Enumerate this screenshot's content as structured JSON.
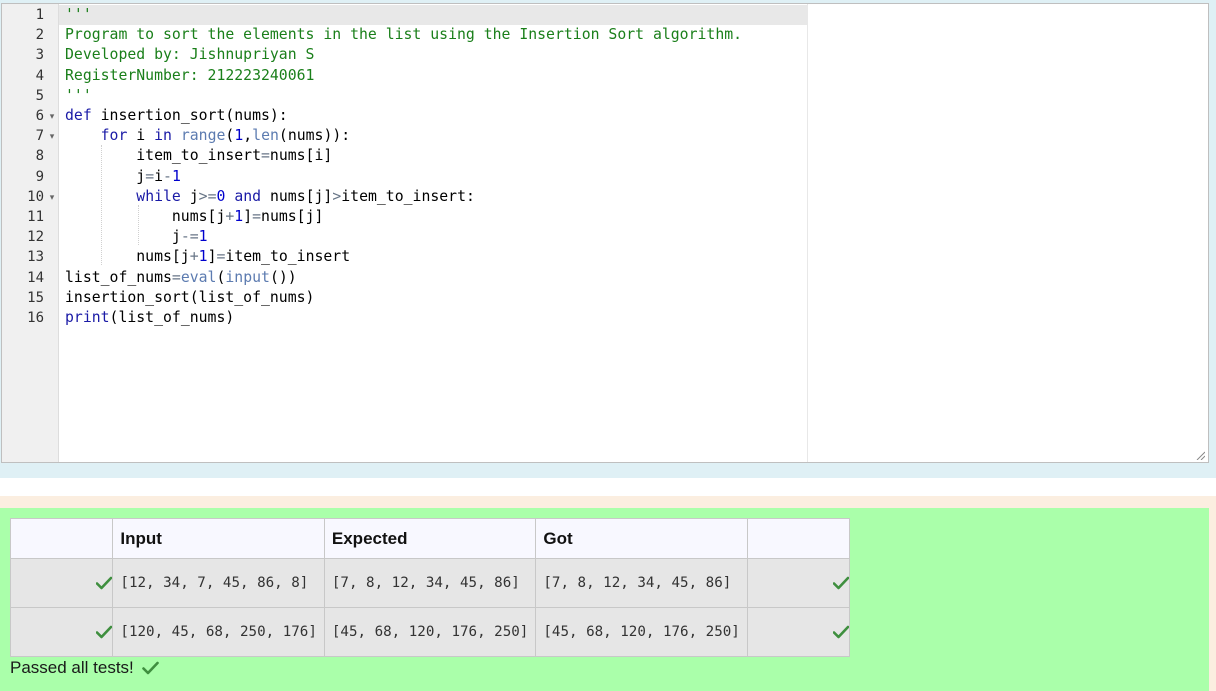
{
  "editor": {
    "line_numbers": [
      "1",
      "2",
      "3",
      "4",
      "5",
      "6",
      "7",
      "8",
      "9",
      "10",
      "11",
      "12",
      "13",
      "14",
      "15",
      "16"
    ],
    "folded_lines": [
      "6",
      "7",
      "10"
    ],
    "code_lines": [
      [
        {
          "t": "'''",
          "c": "str"
        }
      ],
      [
        {
          "t": "Program to sort the elements in the list using the Insertion Sort algorithm.",
          "c": "str"
        }
      ],
      [
        {
          "t": "Developed by: Jishnupriyan S",
          "c": "str"
        }
      ],
      [
        {
          "t": "RegisterNumber: 212223240061",
          "c": "str"
        }
      ],
      [
        {
          "t": "'''",
          "c": "str"
        }
      ],
      [
        {
          "t": "def",
          "c": "kw"
        },
        {
          "t": " insertion_sort(nums):",
          "c": ""
        }
      ],
      [
        {
          "t": "    ",
          "c": ""
        },
        {
          "t": "for",
          "c": "kw"
        },
        {
          "t": " i ",
          "c": ""
        },
        {
          "t": "in",
          "c": "kw"
        },
        {
          "t": " ",
          "c": ""
        },
        {
          "t": "range",
          "c": "bi"
        },
        {
          "t": "(",
          "c": ""
        },
        {
          "t": "1",
          "c": "num"
        },
        {
          "t": ",",
          "c": ""
        },
        {
          "t": "len",
          "c": "bi"
        },
        {
          "t": "(nums)):",
          "c": ""
        }
      ],
      [
        {
          "t": "        item_to_insert",
          "c": ""
        },
        {
          "t": "=",
          "c": "op"
        },
        {
          "t": "nums[i]",
          "c": ""
        }
      ],
      [
        {
          "t": "        j",
          "c": ""
        },
        {
          "t": "=",
          "c": "op"
        },
        {
          "t": "i",
          "c": ""
        },
        {
          "t": "-",
          "c": "op"
        },
        {
          "t": "1",
          "c": "num"
        }
      ],
      [
        {
          "t": "        ",
          "c": ""
        },
        {
          "t": "while",
          "c": "kw"
        },
        {
          "t": " j",
          "c": ""
        },
        {
          "t": ">=",
          "c": "op"
        },
        {
          "t": "0",
          "c": "num"
        },
        {
          "t": " ",
          "c": ""
        },
        {
          "t": "and",
          "c": "kw"
        },
        {
          "t": " nums[j]",
          "c": ""
        },
        {
          "t": ">",
          "c": "op"
        },
        {
          "t": "item_to_insert:",
          "c": ""
        }
      ],
      [
        {
          "t": "            nums[j",
          "c": ""
        },
        {
          "t": "+",
          "c": "op"
        },
        {
          "t": "1",
          "c": "num"
        },
        {
          "t": "]",
          "c": ""
        },
        {
          "t": "=",
          "c": "op"
        },
        {
          "t": "nums[j]",
          "c": ""
        }
      ],
      [
        {
          "t": "            j",
          "c": ""
        },
        {
          "t": "-=",
          "c": "op"
        },
        {
          "t": "1",
          "c": "num"
        }
      ],
      [
        {
          "t": "        nums[j",
          "c": ""
        },
        {
          "t": "+",
          "c": "op"
        },
        {
          "t": "1",
          "c": "num"
        },
        {
          "t": "]",
          "c": ""
        },
        {
          "t": "=",
          "c": "op"
        },
        {
          "t": "item_to_insert",
          "c": ""
        }
      ],
      [
        {
          "t": "list_of_nums",
          "c": ""
        },
        {
          "t": "=",
          "c": "op"
        },
        {
          "t": "eval",
          "c": "bi"
        },
        {
          "t": "(",
          "c": ""
        },
        {
          "t": "input",
          "c": "bi"
        },
        {
          "t": "())",
          "c": ""
        }
      ],
      [
        {
          "t": "insertion_sort(list_of_nums)",
          "c": ""
        }
      ],
      [
        {
          "t": "print",
          "c": "kw"
        },
        {
          "t": "(list_of_nums)",
          "c": ""
        }
      ]
    ]
  },
  "results": {
    "headers": {
      "input": "Input",
      "expected": "Expected",
      "got": "Got"
    },
    "rows": [
      {
        "input": "[12, 34, 7, 45, 86, 8]",
        "expected": "[7, 8, 12, 34, 45, 86]",
        "got": "[7, 8, 12, 34, 45, 86]"
      },
      {
        "input": "[120, 45, 68, 250, 176]",
        "expected": "[45, 68, 120, 176, 250]",
        "got": "[45, 68, 120, 176, 250]"
      }
    ],
    "passed_text": "Passed all tests!",
    "icons": {
      "pass": "check-icon"
    },
    "colors": {
      "pass_green": "#3f8f3f",
      "panel_green": "#aaffaa"
    }
  }
}
